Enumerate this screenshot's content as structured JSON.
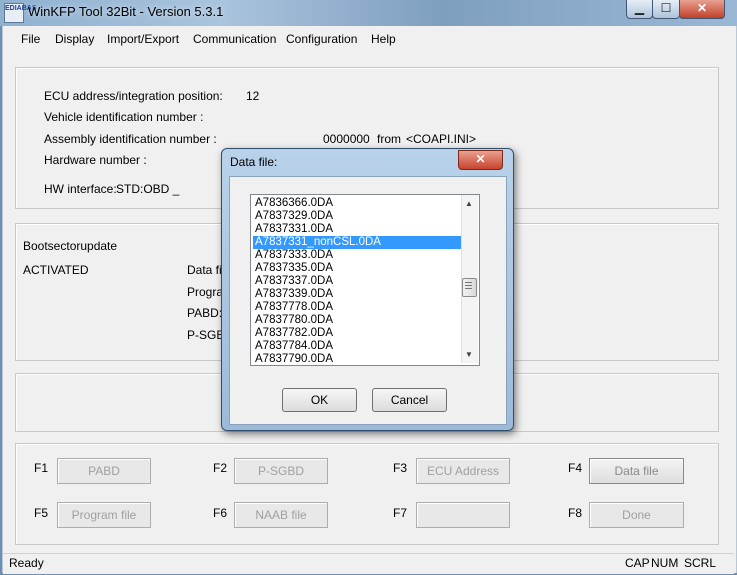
{
  "window": {
    "title": "WinKFP Tool 32Bit - Version 5.3.1",
    "icon_name": "app-icon",
    "icon_text": "EDIABAS"
  },
  "menu": [
    "File",
    "Display",
    "Import/Export",
    "Communication",
    "Configuration",
    "Help"
  ],
  "info": {
    "ecu_address_label": "ECU address/integration position:",
    "ecu_address_value": "12",
    "vin_label": "Vehicle identification number :",
    "assembly_label": "Assembly identification number :",
    "assembly_value": "0000000",
    "assembly_from": "from",
    "assembly_source": "<COAPI.INI>",
    "hardware_label": "Hardware number :",
    "hw_interface_label": "HW interface:",
    "hw_interface_value": "STD:OBD _"
  },
  "bootsector": {
    "title": "Bootsectorupdate",
    "status": "ACTIVATED",
    "fields": [
      "Data fil",
      "Prograr",
      "PABD:",
      "P-SGBI"
    ]
  },
  "function_keys": [
    {
      "key": "F1",
      "label": "PABD"
    },
    {
      "key": "F2",
      "label": "P-SGBD"
    },
    {
      "key": "F3",
      "label": "ECU Address"
    },
    {
      "key": "F4",
      "label": "Data file"
    },
    {
      "key": "F5",
      "label": "Program file"
    },
    {
      "key": "F6",
      "label": "NAAB file"
    },
    {
      "key": "F7",
      "label": ""
    },
    {
      "key": "F8",
      "label": "Done"
    }
  ],
  "status": {
    "left": "Ready",
    "cap": "CAP",
    "num": "NUM",
    "scrl": "SCRL"
  },
  "dialog": {
    "title": "Data file:",
    "close": "✕",
    "files": [
      "A7836366.0DA",
      "A7837329.0DA",
      "A7837331.0DA",
      "A7837331_nonCSL.0DA",
      "A7837333.0DA",
      "A7837335.0DA",
      "A7837337.0DA",
      "A7837339.0DA",
      "A7837778.0DA",
      "A7837780.0DA",
      "A7837782.0DA",
      "A7837784.0DA",
      "A7837790.0DA"
    ],
    "selected_file": "A7837331_nonCSL.0DA",
    "ok": "OK",
    "cancel": "Cancel"
  },
  "colors": {
    "selection": "#3399ff",
    "titlebar": "#8fb1d0",
    "close_button": "#c7442c"
  }
}
